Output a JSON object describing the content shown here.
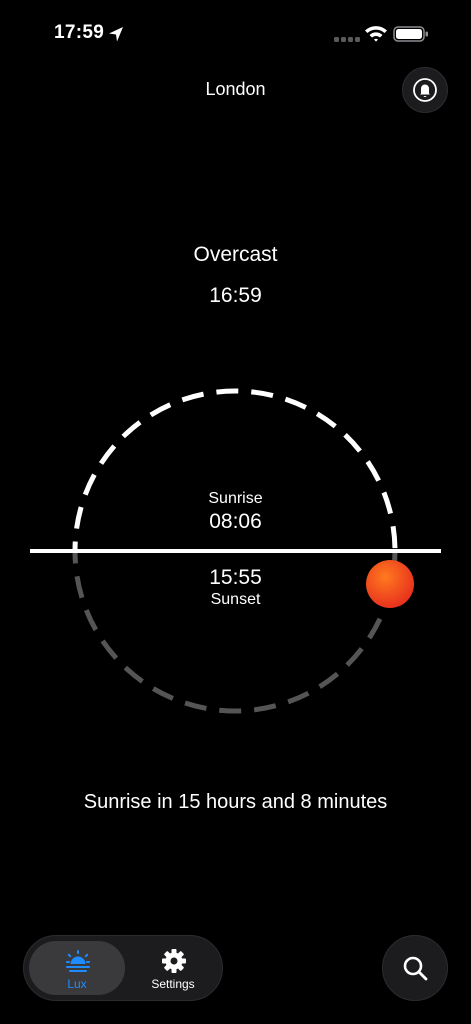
{
  "status_bar": {
    "time": "17:59"
  },
  "header": {
    "city": "London"
  },
  "weather": {
    "condition": "Overcast",
    "current_time": "16:59"
  },
  "sun_dial": {
    "sunrise_label": "Sunrise",
    "sunrise_time": "08:06",
    "sunset_time": "15:55",
    "sunset_label": "Sunset",
    "sun_color": "#f0461e"
  },
  "next_event": "Sunrise in 15 hours and 8 minutes",
  "tab_bar": {
    "tabs": [
      {
        "label": "Lux",
        "icon": "sunrise-icon",
        "active": true
      },
      {
        "label": "Settings",
        "icon": "gear-icon",
        "active": false
      }
    ]
  },
  "colors": {
    "accent": "#1e8cff",
    "background": "#000000"
  }
}
